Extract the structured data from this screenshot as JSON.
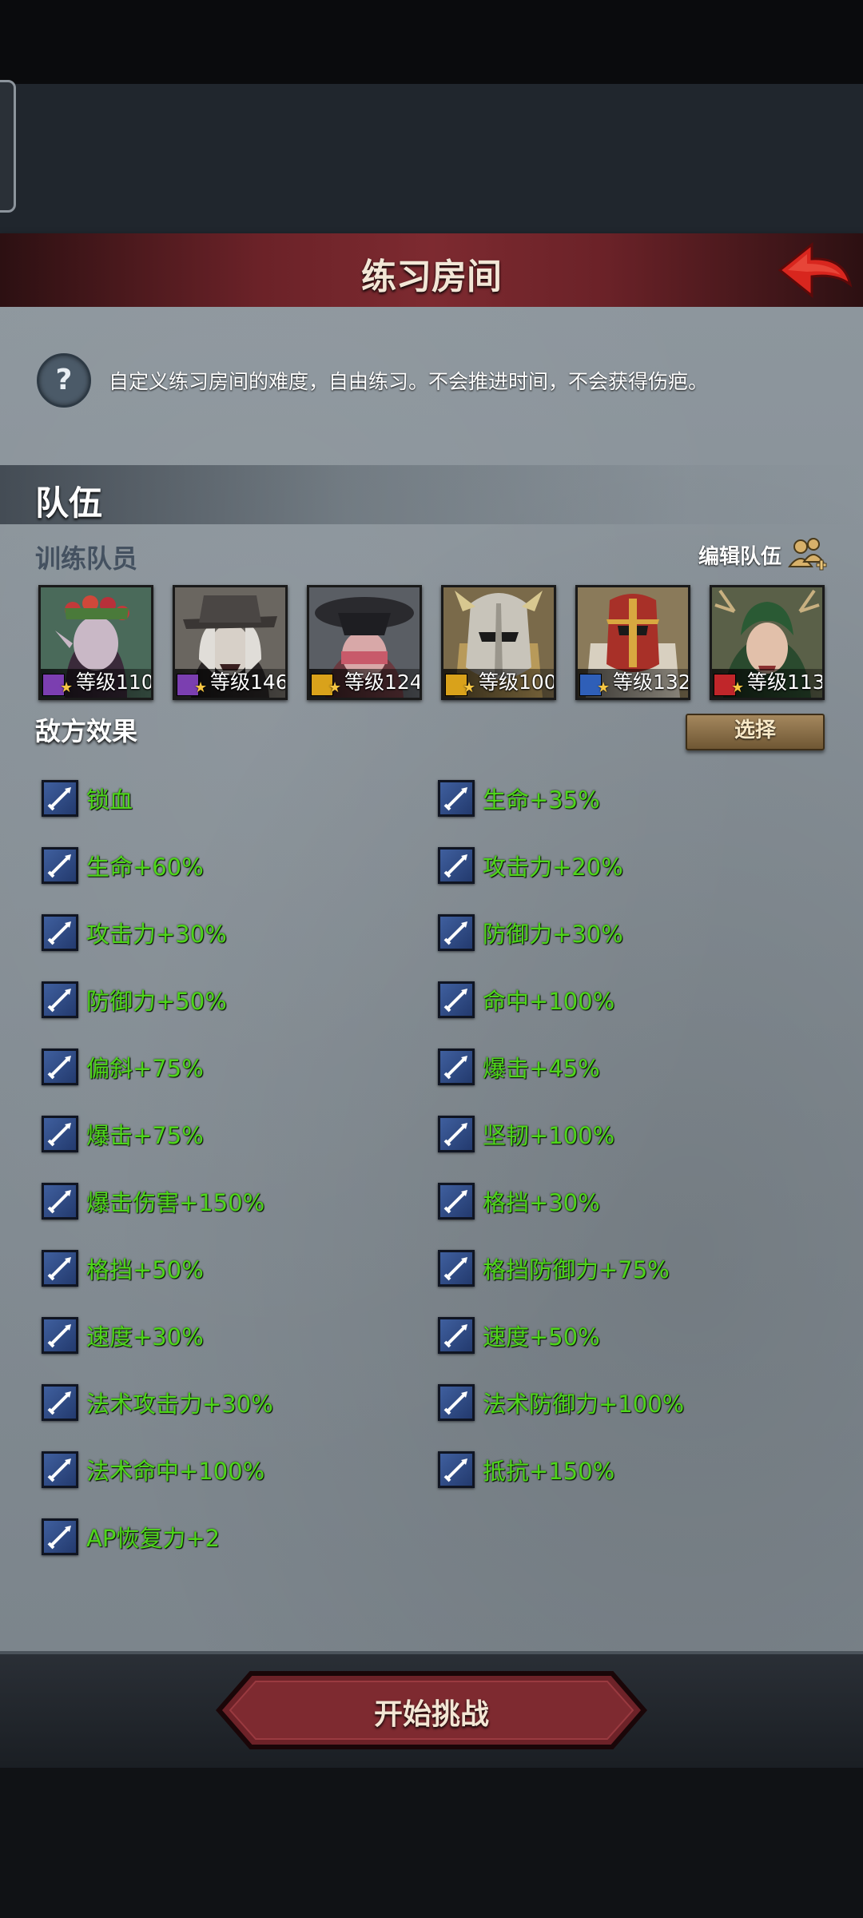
{
  "header": {
    "title": "练习房间"
  },
  "info": {
    "text": "自定义练习房间的难度，自由练习。不会推进时间，不会获得伤疤。",
    "icon": "?"
  },
  "team": {
    "section_title": "队伍",
    "trainees_label": "训练队员",
    "edit_label": "编辑队伍",
    "heroes": [
      {
        "level": "等级110",
        "class_color": "#7b3fb0",
        "class_icon": "staff-icon"
      },
      {
        "level": "等级146",
        "class_color": "#7b3fb0",
        "class_icon": "staff-icon"
      },
      {
        "level": "等级124",
        "class_color": "#d9a21b",
        "class_icon": "shield-icon"
      },
      {
        "level": "等级100",
        "class_color": "#d9a21b",
        "class_icon": "shield-icon"
      },
      {
        "level": "等级132",
        "class_color": "#2f5fb8",
        "class_icon": "sword-icon"
      },
      {
        "level": "等级113",
        "class_color": "#c0262a",
        "class_icon": "horse-icon"
      }
    ]
  },
  "enemy": {
    "title": "敌方效果",
    "select_label": "选择",
    "effects_left": [
      "锁血",
      "生命+60%",
      "攻击力+30%",
      "防御力+50%",
      "偏斜+75%",
      "爆击+75%",
      "爆击伤害+150%",
      "格挡+50%",
      "速度+30%",
      "法术攻击力+30%",
      "法术命中+100%",
      "AP恢复力+2"
    ],
    "effects_right": [
      "生命+35%",
      "攻击力+20%",
      "防御力+30%",
      "命中+100%",
      "爆击+45%",
      "坚韧+100%",
      "格挡+30%",
      "格挡防御力+75%",
      "速度+50%",
      "法术防御力+100%",
      "抵抗+150%"
    ]
  },
  "footer": {
    "start_label": "开始挑战"
  },
  "colors": {
    "effect_text": "#4fd51b",
    "header_red": "#7d2a30",
    "accent_gold": "#f5c542"
  }
}
